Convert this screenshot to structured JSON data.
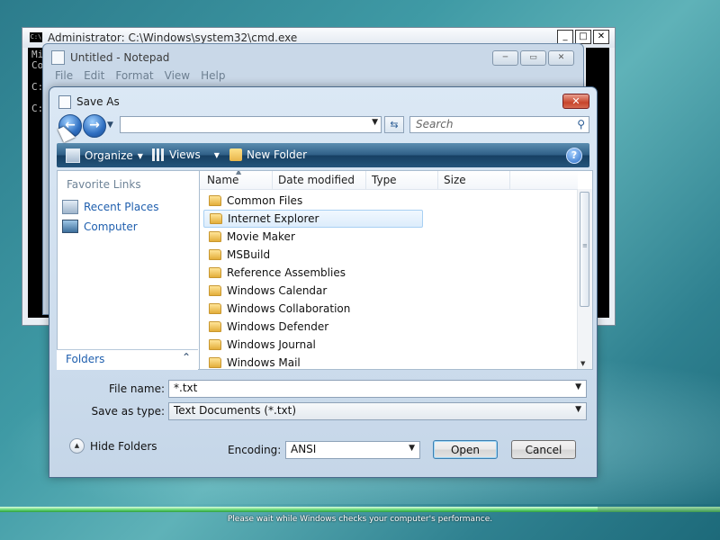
{
  "desktop": {
    "status_text": "Please wait while Windows checks your computer's performance.",
    "progress_fraction": 0.83
  },
  "cmd": {
    "title": "Administrator: C:\\Windows\\system32\\cmd.exe",
    "icon_text": "C:\\",
    "lines": [
      "Mi",
      "Co",
      "",
      "C:",
      "",
      "C:"
    ],
    "buttons": [
      "_",
      "□",
      "✕"
    ]
  },
  "notepad": {
    "title": "Untitled - Notepad",
    "menu": [
      "File",
      "Edit",
      "Format",
      "View",
      "Help"
    ],
    "buttons": [
      "─",
      "▭",
      "✕"
    ]
  },
  "dialog": {
    "title": "Save As",
    "close_glyph": "✕",
    "address": "",
    "search_placeholder": "Search",
    "toolbar": {
      "organize": "Organize",
      "views": "Views",
      "new_folder": "New Folder",
      "help": "?"
    },
    "favorites": {
      "heading": "Favorite Links",
      "items": [
        "Recent Places",
        "Computer"
      ]
    },
    "folders_label": "Folders",
    "columns": [
      "Name",
      "Date modified",
      "Type",
      "Size"
    ],
    "files": [
      "Common Files",
      "Internet Explorer",
      "Movie Maker",
      "MSBuild",
      "Reference Assemblies",
      "Windows Calendar",
      "Windows Collaboration",
      "Windows Defender",
      "Windows Journal",
      "Windows Mail"
    ],
    "selected_file": "Internet Explorer",
    "file_name_label": "File name:",
    "file_name_value": "*.txt",
    "save_as_type_label": "Save as type:",
    "save_as_type_value": "Text Documents (*.txt)",
    "hide_folders": "Hide Folders",
    "encoding_label": "Encoding:",
    "encoding_value": "ANSI",
    "open_button": "Open",
    "cancel_button": "Cancel"
  }
}
